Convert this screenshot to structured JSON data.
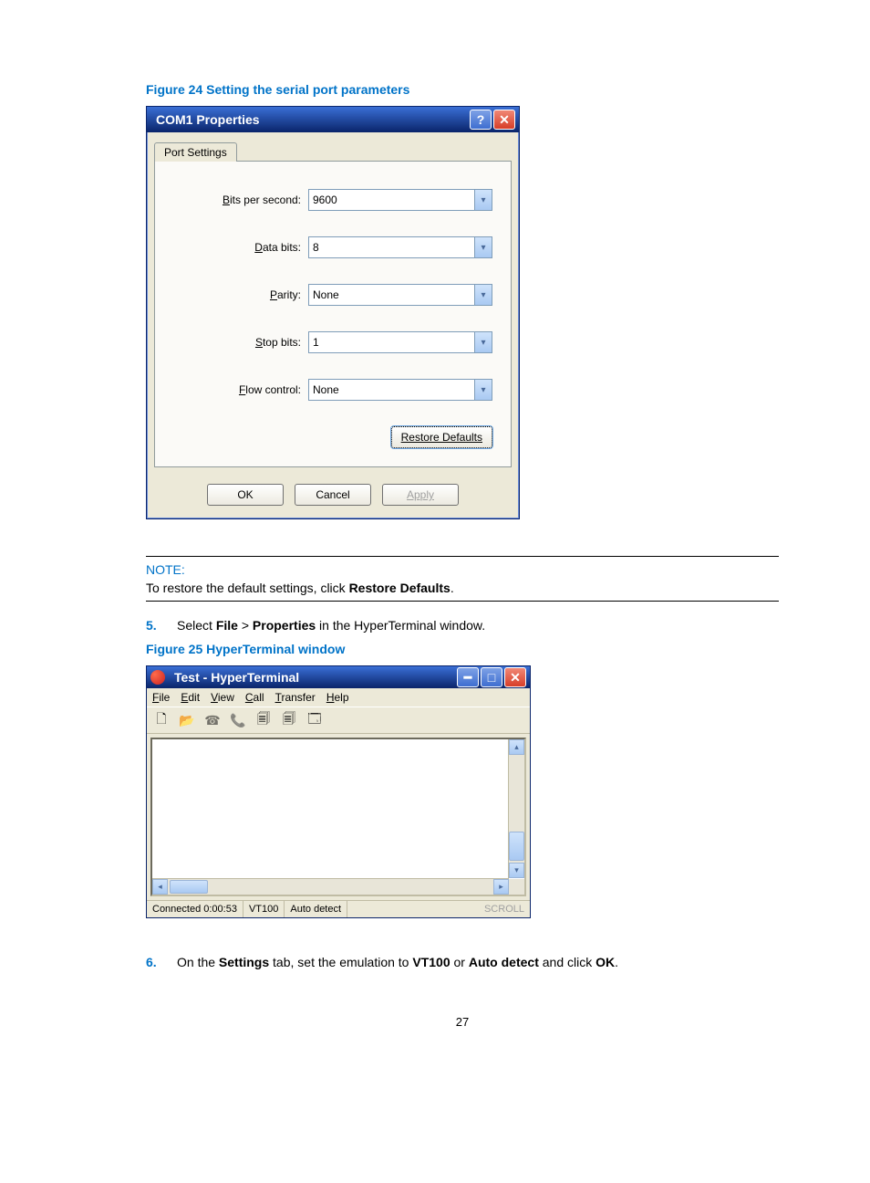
{
  "figure24_caption": "Figure 24 Setting the serial port parameters",
  "dlg": {
    "title": "COM1 Properties",
    "tab_label": "Port Settings",
    "fields": {
      "bits_label": "Bits per second:",
      "bits_value": "9600",
      "data_label": "Data bits:",
      "data_value": "8",
      "parity_label": "Parity:",
      "parity_value": "None",
      "stop_label": "Stop bits:",
      "stop_value": "1",
      "flow_label": "Flow control:",
      "flow_value": "None"
    },
    "restore_label": "Restore Defaults",
    "ok_label": "OK",
    "cancel_label": "Cancel",
    "apply_label": "Apply"
  },
  "note": {
    "head": "NOTE:",
    "body_pre": "To restore the default settings, click ",
    "body_bold": "Restore Defaults",
    "body_post": "."
  },
  "step5": {
    "num": "5.",
    "pre": "Select ",
    "b1": "File",
    "mid1": " > ",
    "b2": "Properties",
    "post": " in the HyperTerminal window."
  },
  "figure25_caption": "Figure 25 HyperTerminal window",
  "ht": {
    "title": "Test - HyperTerminal",
    "menu": {
      "file": "File",
      "edit": "Edit",
      "view": "View",
      "call": "Call",
      "transfer": "Transfer",
      "help": "Help"
    },
    "status": {
      "connected": "Connected 0:00:53",
      "emu": "VT100",
      "detect": "Auto detect",
      "scroll": "SCROLL"
    }
  },
  "step6": {
    "num": "6.",
    "pre": "On the ",
    "b1": "Settings",
    "mid1": " tab, set the emulation to ",
    "b2": "VT100",
    "mid2": " or ",
    "b3": "Auto detect",
    "mid3": " and click ",
    "b4": "OK",
    "post": "."
  },
  "page_number": "27"
}
